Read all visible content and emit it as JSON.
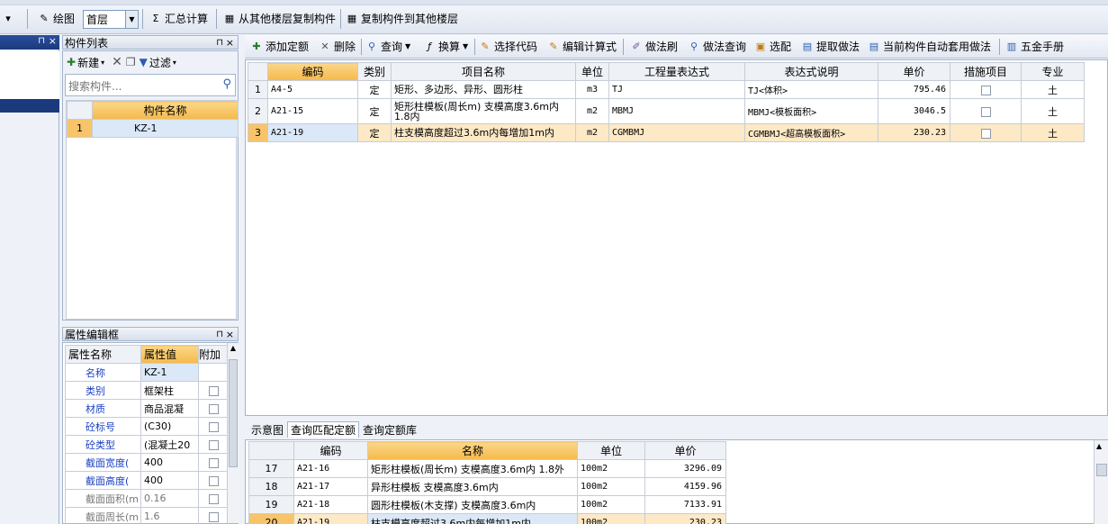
{
  "toolbar": {
    "draw_label": "绘图",
    "floor_value": "首层",
    "sum_label": "汇总计算",
    "copy_from_label": "从其他楼层复制构件",
    "copy_to_label": "复制构件到其他楼层"
  },
  "component_panel": {
    "title": "构件列表",
    "new_label": "新建",
    "filter_label": "过滤",
    "search_placeholder": "搜索构件...",
    "header": "构件名称",
    "items": [
      {
        "num": "1",
        "name": "KZ-1"
      }
    ]
  },
  "property_panel": {
    "title": "属性编辑框",
    "headers": {
      "name": "属性名称",
      "value": "属性值",
      "extra": "附加"
    },
    "rows": [
      {
        "name": "名称",
        "value": "KZ-1",
        "checkbox": false
      },
      {
        "name": "类别",
        "value": "框架柱",
        "checkbox": true
      },
      {
        "name": "材质",
        "value": "商品混凝",
        "checkbox": true
      },
      {
        "name": "砼标号",
        "value": "(C30)",
        "checkbox": true
      },
      {
        "name": "砼类型",
        "value": "(混凝土20",
        "checkbox": true
      },
      {
        "name": "截面宽度(",
        "value": "400",
        "checkbox": true
      },
      {
        "name": "截面高度(",
        "value": "400",
        "checkbox": true
      },
      {
        "name": "截面面积(m",
        "value": "0.16",
        "checkbox": true
      },
      {
        "name": "截面周长(m",
        "value": "1.6",
        "checkbox": true
      }
    ]
  },
  "quota_toolbar": {
    "add": "添加定额",
    "delete": "删除",
    "query": "查询",
    "convert": "换算",
    "select_code": "选择代码",
    "edit_formula": "编辑计算式",
    "method_brush": "做法刷",
    "method_query": "做法查询",
    "select_match": "选配",
    "extract": "提取做法",
    "auto_apply": "当前构件自动套用做法",
    "hardware": "五金手册"
  },
  "quota_table": {
    "headers": [
      "编码",
      "类别",
      "项目名称",
      "单位",
      "工程量表达式",
      "表达式说明",
      "单价",
      "措施项目",
      "专业"
    ],
    "rows": [
      {
        "num": "1",
        "code": "A4-5",
        "type": "定",
        "name": "矩形、多边形、异形、圆形柱",
        "name2": "",
        "unit": "m3",
        "expr": "TJ",
        "desc": "TJ<体积>",
        "price": "795.46",
        "spec": "土"
      },
      {
        "num": "2",
        "code": "A21-15",
        "type": "定",
        "name": "矩形柱模板(周长m) 支模高度3.6m内",
        "name2": "1.8内",
        "unit": "m2",
        "expr": "MBMJ",
        "desc": "MBMJ<模板面积>",
        "price": "3046.5",
        "spec": "土"
      },
      {
        "num": "3",
        "code": "A21-19",
        "type": "定",
        "name": "柱支模高度超过3.6m内每增加1m内",
        "name2": "",
        "unit": "m2",
        "expr": "CGMBMJ",
        "desc": "CGMBMJ<超高模板面积>",
        "price": "230.23",
        "spec": "土"
      }
    ]
  },
  "bottom_tabs": [
    "示意图",
    "查询匹配定额",
    "查询定额库"
  ],
  "match_table": {
    "headers": [
      "编码",
      "名称",
      "单位",
      "单价"
    ],
    "rows": [
      {
        "num": "17",
        "code": "A21-16",
        "name": "矩形柱模板(周长m) 支模高度3.6m内 1.8外",
        "unit": "100m2",
        "price": "3296.09"
      },
      {
        "num": "18",
        "code": "A21-17",
        "name": "异形柱模板 支模高度3.6m内",
        "unit": "100m2",
        "price": "4159.96"
      },
      {
        "num": "19",
        "code": "A21-18",
        "name": "圆形柱模板(木支撑) 支模高度3.6m内",
        "unit": "100m2",
        "price": "7133.91"
      },
      {
        "num": "20",
        "code": "A21-19",
        "name": "柱支模高度超过3.6m内每增加1m内",
        "unit": "100m2",
        "price": "230.23"
      }
    ]
  }
}
